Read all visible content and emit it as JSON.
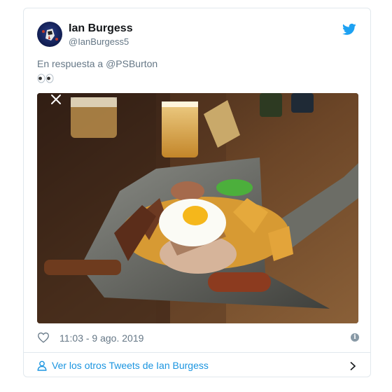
{
  "tweet": {
    "author_name": "Ian Burgess",
    "author_handle": "@IanBurgess5",
    "reply_prefix": "En respuesta a",
    "reply_mention": "@PSBurton",
    "body_emoji": "👀",
    "timestamp": "11:03 - 9 ago. 2019",
    "info_glyph": "i"
  },
  "footer": {
    "link_label": "Ver los otros Tweets de Ian Burgess"
  },
  "colors": {
    "twitter_blue": "#1da1f2",
    "link_blue": "#1b95e0",
    "secondary_text": "#657786",
    "border": "#e1e8ed"
  },
  "icons": {
    "brand": "twitter-bird-icon",
    "like": "heart-icon",
    "info": "info-icon",
    "close": "close-icon",
    "profile": "person-icon",
    "more": "chevron-right-icon"
  }
}
